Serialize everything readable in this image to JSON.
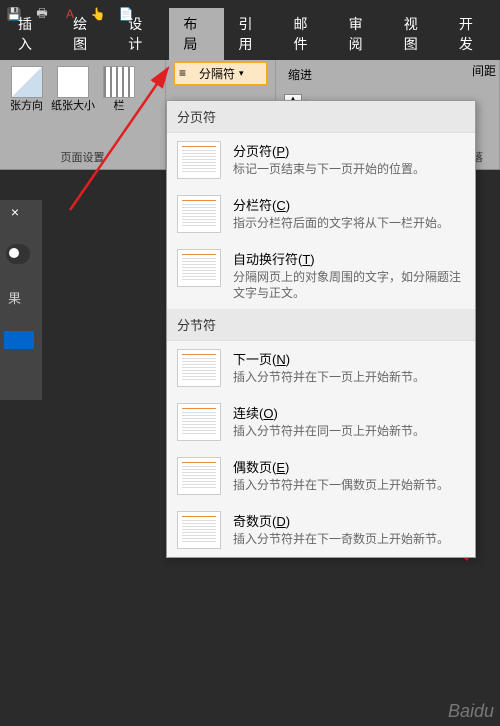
{
  "tabs": {
    "insert": "插入",
    "draw": "绘图",
    "design": "设计",
    "layout": "布局",
    "references": "引用",
    "mailings": "邮件",
    "review": "审阅",
    "view": "视图",
    "dev": "开发"
  },
  "ribbon": {
    "orientation": "张方向",
    "size": "纸张大小",
    "columns": "栏",
    "breaks": "分隔符",
    "indent": "缩进",
    "spacing": "间距",
    "group_page_setup": "页面设置",
    "group_paragraph": "段落"
  },
  "dropdown": {
    "section1": "分页符",
    "section2": "分节符",
    "items": [
      {
        "title": "分页符(P)",
        "desc": "标记一页结束与下一页开始的位置。"
      },
      {
        "title": "分栏符(C)",
        "desc": "指示分栏符后面的文字将从下一栏开始。"
      },
      {
        "title": "自动换行符(T)",
        "desc": "分隔网页上的对象周围的文字，如分隔题注文字与正文。"
      },
      {
        "title": "下一页(N)",
        "desc": "插入分节符并在下一页上开始新节。"
      },
      {
        "title": "连续(O)",
        "desc": "插入分节符并在同一页上开始新节。"
      },
      {
        "title": "偶数页(E)",
        "desc": "插入分节符并在下一偶数页上开始新节。"
      },
      {
        "title": "奇数页(D)",
        "desc": "插入分节符并在下一奇数页上开始新节。"
      }
    ]
  },
  "side": {
    "result": "果"
  },
  "watermark": "Baidu"
}
